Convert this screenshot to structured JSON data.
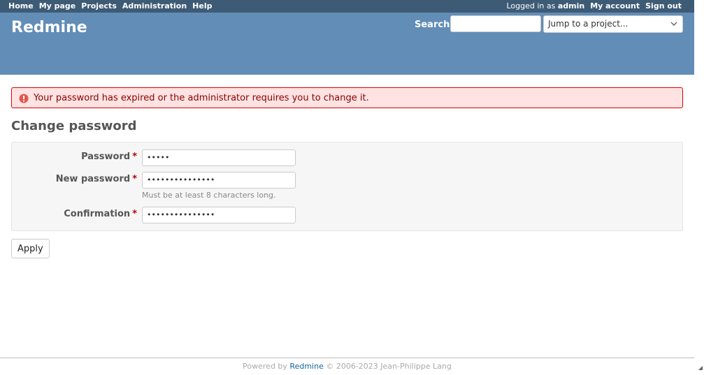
{
  "top_menu": {
    "left": [
      "Home",
      "My page",
      "Projects",
      "Administration",
      "Help"
    ],
    "logged_in_prefix": "Logged in as",
    "user": "admin",
    "my_account": "My account",
    "sign_out": "Sign out"
  },
  "header": {
    "title": "Redmine",
    "search_label": "Search:",
    "search_value": "",
    "jump_placeholder": "Jump to a project..."
  },
  "flash": {
    "icon": "error-circle-icon",
    "message": "Your password has expired or the administrator requires you to change it."
  },
  "form": {
    "title": "Change password",
    "required_mark": "*",
    "fields": [
      {
        "label": "Password",
        "value": "•••••"
      },
      {
        "label": "New password",
        "value": "•••••••••••••••",
        "hint": "Must be at least 8 characters long."
      },
      {
        "label": "Confirmation",
        "value": "•••••••••••••••"
      }
    ],
    "submit": "Apply"
  },
  "footer": {
    "prefix": "Powered by",
    "link": "Redmine",
    "suffix": "© 2006-2023 Jean-Philippe Lang"
  },
  "colors": {
    "top_menu_bg": "#3E5B76",
    "header_bg": "#628DB6",
    "flash_bg": "#ffe3e3",
    "flash_border": "#dd0000",
    "link": "#169"
  }
}
